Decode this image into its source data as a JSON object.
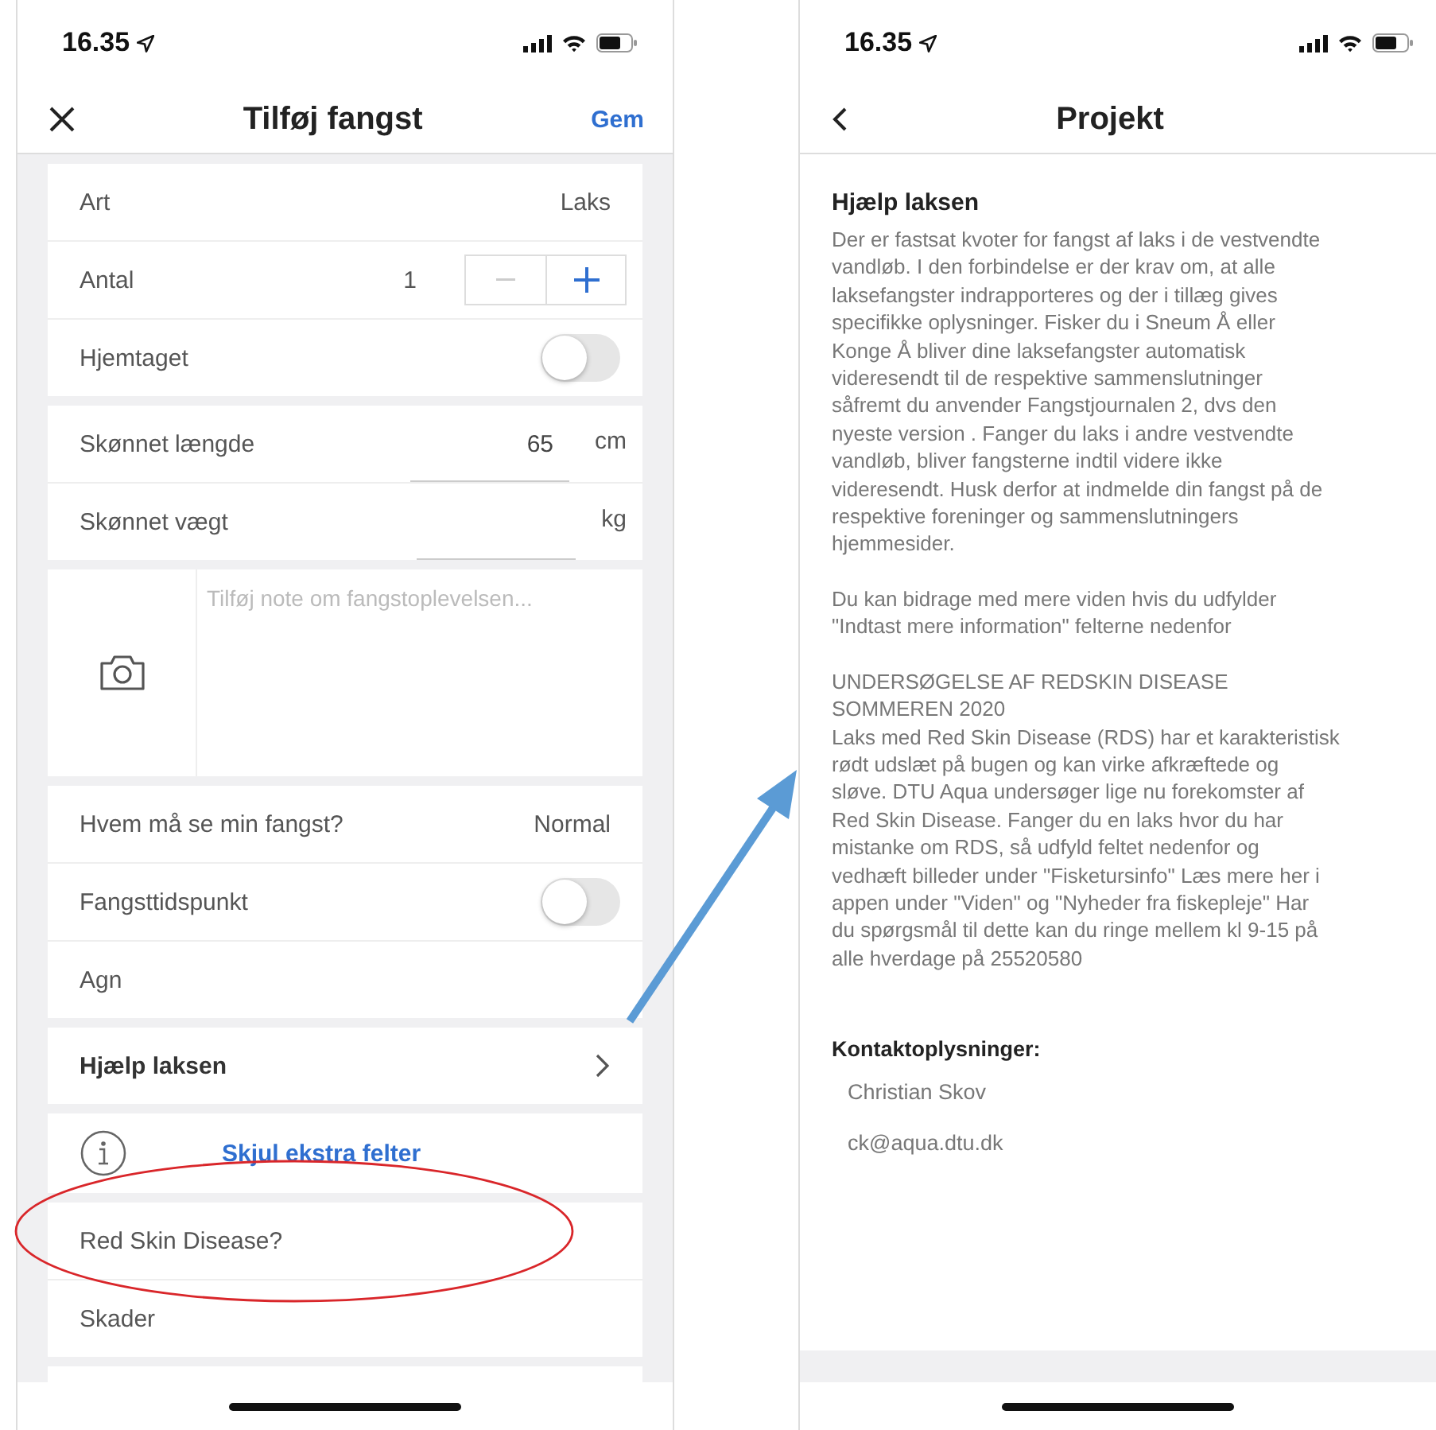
{
  "left_screen": {
    "status_bar": {
      "time": "16.35"
    },
    "nav": {
      "title": "Tilføj fangst",
      "action": "Gem"
    },
    "sections": [
      {
        "kind": "rows",
        "rows": [
          {
            "kind": "value",
            "label": "Art",
            "value": "Laks"
          },
          {
            "kind": "stepper",
            "label": "Antal",
            "value": "1"
          },
          {
            "kind": "toggle",
            "label": "Hjemtaget",
            "on": false
          }
        ]
      },
      {
        "kind": "rows",
        "rows": [
          {
            "kind": "input",
            "label": "Skønnet længde",
            "value": "65",
            "unit": "cm"
          },
          {
            "kind": "input",
            "label": "Skønnet vægt",
            "unit": "kg"
          }
        ]
      },
      {
        "kind": "note",
        "placeholder": "Tilføj note om fangstoplevelsen..."
      },
      {
        "kind": "rows",
        "rows": [
          {
            "kind": "value",
            "label": "Hvem må se min fangst?",
            "value": "Normal"
          },
          {
            "kind": "toggle",
            "label": "Fangsttidspunkt",
            "on": false
          },
          {
            "kind": "plain",
            "label": "Agn"
          }
        ]
      },
      {
        "kind": "rows",
        "rows": [
          {
            "kind": "link",
            "label": "Hjælp laksen"
          }
        ]
      },
      {
        "kind": "rows",
        "rows": [
          {
            "kind": "info",
            "label": "Skjul ekstra felter"
          }
        ]
      },
      {
        "kind": "rows",
        "rows": [
          {
            "kind": "plain",
            "label": "Red Skin Disease?"
          },
          {
            "kind": "plain",
            "label": "Skader"
          }
        ]
      }
    ]
  },
  "right_screen": {
    "status_bar": {
      "time": "16.35"
    },
    "nav": {
      "title": "Projekt"
    },
    "heading": "Hjælp laksen",
    "paragraphs": [
      "Der er fastsat kvoter for fangst af laks i de vestvendte\nvandløb. I den forbindelse er der krav om, at alle\nlaksefangster indrapporteres og der i tillæg gives\nspecifikke oplysninger. Fisker du i Sneum Å eller\nKonge Å bliver dine laksefangster automatisk\nvideresendt til de respektive sammenslutninger\nsåfremt du anvender Fangstjournalen 2, dvs den\nnyeste version . Fanger du laks i andre vestvendte\nvandløb, bliver fangsterne indtil videre ikke\nvideresendt. Husk derfor at indmelde din fangst på de\nrespektive foreninger og sammenslutningers\nhjemmesider.",
      "Du kan bidrage med mere viden hvis du udfylder\n\"Indtast mere information\" felterne nedenfor",
      "UNDERSØGELSE AF REDSKIN DISEASE\nSOMMEREN 2020\nLaks med Red Skin Disease (RDS) har et karakteristisk\nrødt udslæt på bugen og kan virke afkræftede og\nsløve. DTU Aqua undersøger lige nu forekomster af\nRed Skin Disease. Fanger du en laks hvor du har\nmistanke om RDS, så udfyld feltet nedenfor og\nvedhæft billeder under \"Fisketursinfo\" Læs mere her i\nappen under \"Viden\" og \"Nyheder fra fiskepleje\" Har\ndu spørgsmål til dette kan du ringe mellem kl 9-15 på\nalle hverdage på 25520580"
    ],
    "contact_heading": "Kontaktoplysninger:",
    "contacts": [
      "Christian Skov",
      "ck@aqua.dtu.dk"
    ]
  }
}
